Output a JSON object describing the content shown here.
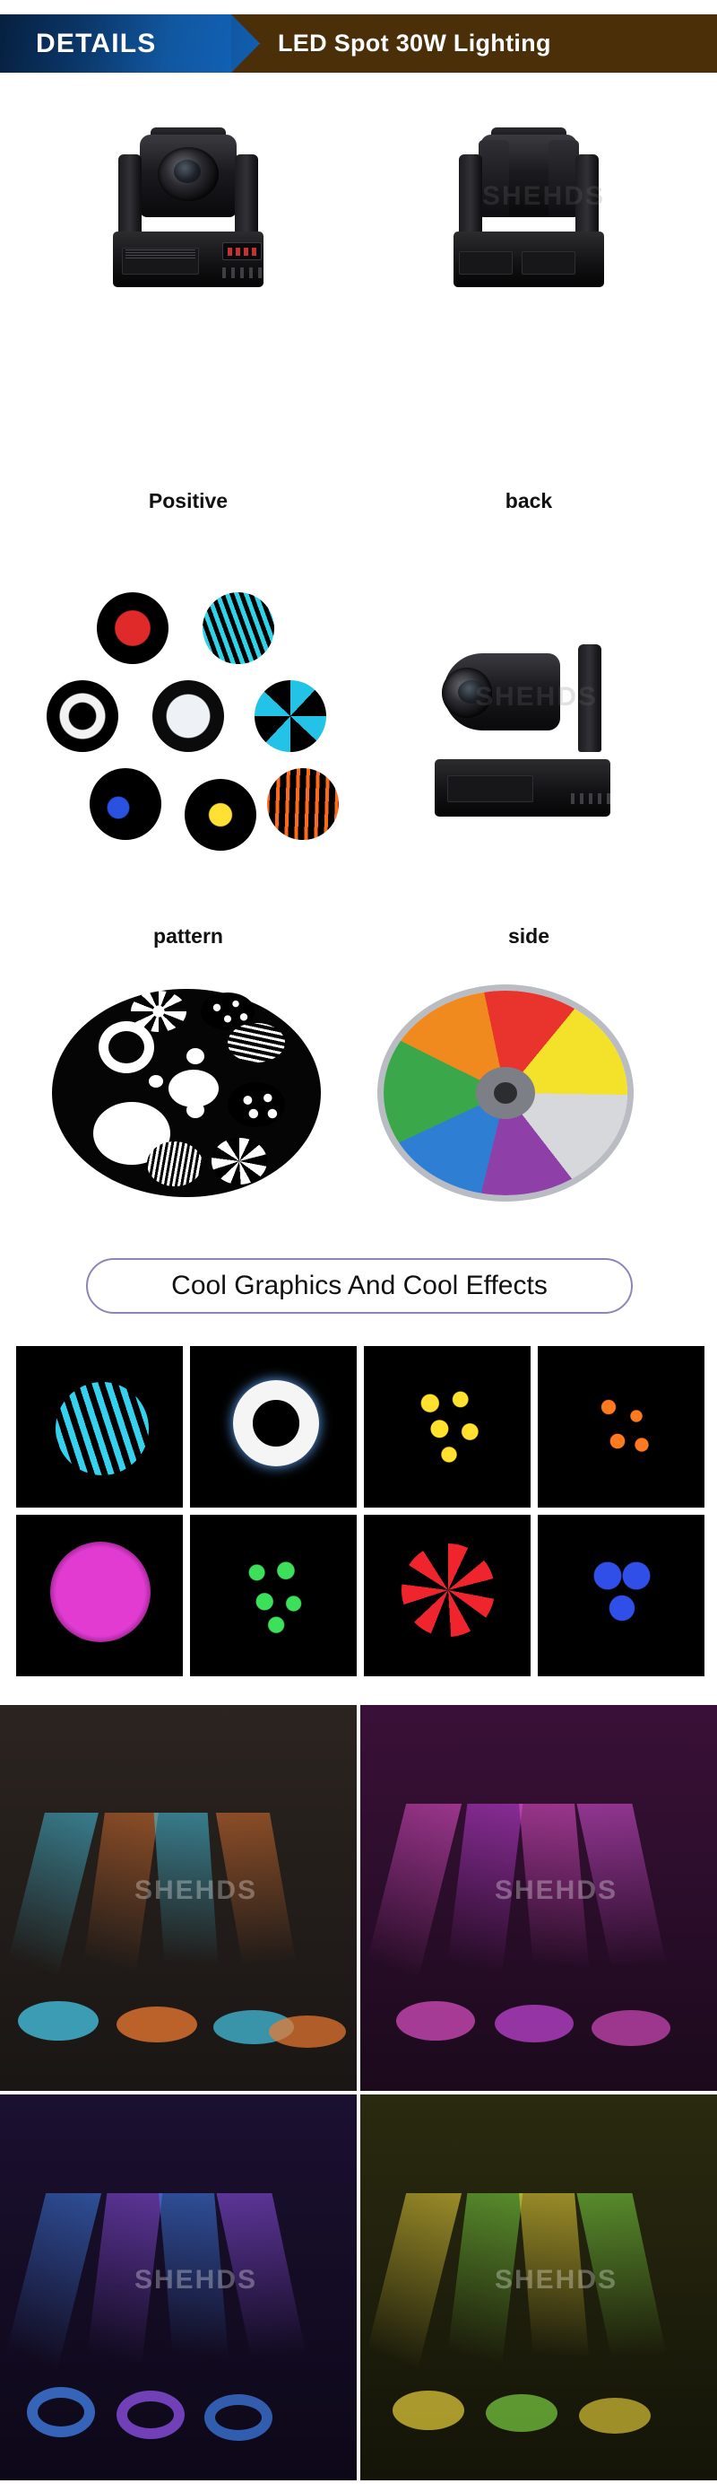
{
  "header": {
    "tag_label": "DETAILS",
    "title": "LED Spot 30W Lighting",
    "blue_hex": "#0b3668",
    "brown_hex": "#4a2f09"
  },
  "watermark": {
    "text": "SHEHDS"
  },
  "product_views": [
    {
      "id": "positive",
      "caption": "Positive"
    },
    {
      "id": "back",
      "caption": "back"
    },
    {
      "id": "pattern",
      "caption": "pattern"
    },
    {
      "id": "side",
      "caption": "side"
    }
  ],
  "gobo_swatches": [
    {
      "name": "red-rosette-gobo",
      "color": "#e02a2a"
    },
    {
      "name": "cyan-stripes-gobo",
      "color": "#2fd3e8"
    },
    {
      "name": "white-ring-gobo",
      "color": "#f2f2f2"
    },
    {
      "name": "white-disc-gobo",
      "color": "#eef2f6"
    },
    {
      "name": "cyan-swirl-gobo",
      "color": "#22c3e6"
    },
    {
      "name": "blue-dots-gobo",
      "color": "#2a52e0"
    },
    {
      "name": "yellow-dots-gobo",
      "color": "#ffe033"
    },
    {
      "name": "orange-bars-gobo",
      "color": "#ff6a1a"
    }
  ],
  "wheels": [
    {
      "name": "gobo-wheel",
      "label": "gobo wheel"
    },
    {
      "name": "color-wheel",
      "label": "color wheel",
      "colors": [
        "#e8342c",
        "#2e7fd4",
        "#3aa84a",
        "#f4e12a",
        "#8e3fa8",
        "#f08a1e",
        "#d6d8db"
      ]
    }
  ],
  "pill_banner": {
    "text": "Cool Graphics And Cool Effects"
  },
  "effect_tiles": [
    {
      "name": "cyan-stripes-effect",
      "color": "#34d2ef"
    },
    {
      "name": "white-ring-effect",
      "color": "#f5f5f5"
    },
    {
      "name": "yellow-dots-effect",
      "color": "#ffe12e"
    },
    {
      "name": "orange-specks-effect",
      "color": "#ff7a1f"
    },
    {
      "name": "magenta-disc-effect",
      "color": "#e23bd2"
    },
    {
      "name": "green-dots-effect",
      "color": "#3de05a"
    },
    {
      "name": "red-swirl-effect",
      "color": "#f0242c"
    },
    {
      "name": "blue-cluster-effect",
      "color": "#2f4fe8"
    }
  ],
  "stage_photos": [
    {
      "name": "stage-photo-cyan-orange",
      "beams": [
        "#46c8e8",
        "#f07a32",
        "#46c8e8",
        "#f07a32"
      ]
    },
    {
      "name": "stage-photo-magenta",
      "beams": [
        "#e050c8",
        "#c040d8",
        "#e050c8",
        "#d050d0"
      ]
    },
    {
      "name": "stage-photo-blue-purple",
      "beams": [
        "#3e7ae0",
        "#8a4fe0",
        "#3e7ae0",
        "#8a4fe0"
      ]
    },
    {
      "name": "stage-photo-yellow-green",
      "beams": [
        "#e8d03a",
        "#7ad040",
        "#e8d03a",
        "#7ad040"
      ]
    }
  ]
}
